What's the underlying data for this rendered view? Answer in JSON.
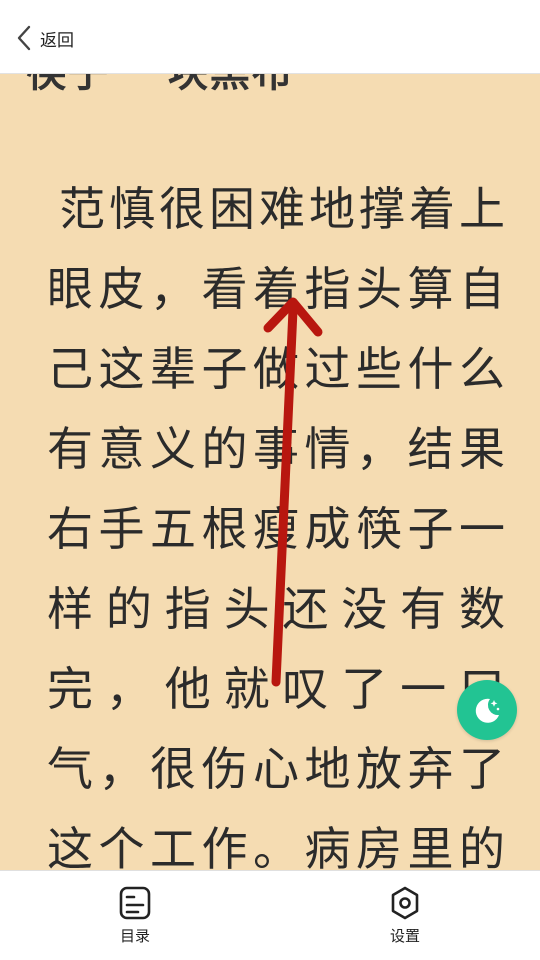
{
  "header": {
    "back_label": "返回"
  },
  "reader": {
    "previous_line_partial": "筷子 一块黑布",
    "paragraph": "范慎很困难地撑着上眼皮，看着指头算自己这辈子做过些什么有意义的事情，结果右手五根瘦成筷子一样的指头还没有数完，他就叹了一口气，很伤心地放弃了这个工作。病房里的药水"
  },
  "floating": {
    "night_mode_icon": "moon-stars-icon",
    "color": "#22C493"
  },
  "bottom_nav": {
    "items": [
      {
        "label": "目录",
        "icon": "toc-icon"
      },
      {
        "label": "设置",
        "icon": "settings-hex-icon"
      }
    ]
  },
  "colors": {
    "page_background": "#F5DCB2",
    "text": "#2B2B2B",
    "annotation_arrow": "#B8170F"
  }
}
